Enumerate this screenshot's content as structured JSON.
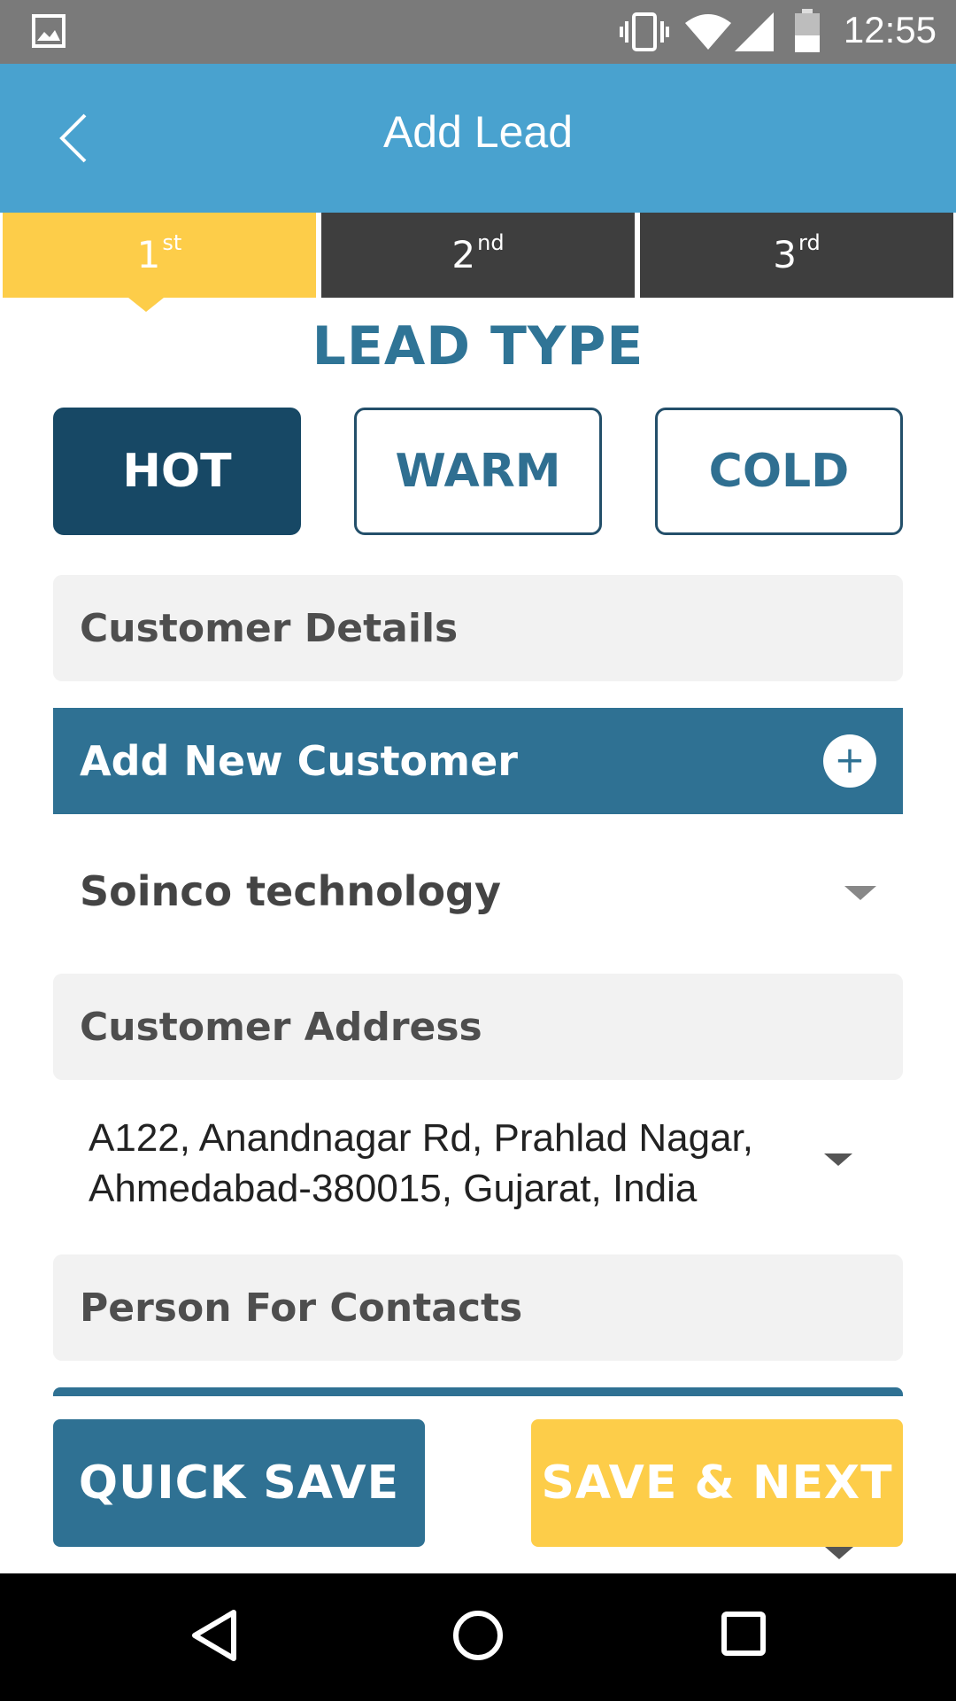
{
  "status_bar": {
    "time": "12:55"
  },
  "app_bar": {
    "title": "Add Lead"
  },
  "steps": [
    {
      "num": "1",
      "suffix": "st"
    },
    {
      "num": "2",
      "suffix": "nd"
    },
    {
      "num": "3",
      "suffix": "rd"
    }
  ],
  "lead_type": {
    "title": "LEAD TYPE",
    "options": [
      "HOT",
      "WARM",
      "COLD"
    ],
    "selected": "HOT"
  },
  "customer_details": {
    "label": "Customer Details",
    "add_new_label": "Add New Customer",
    "selected_customer": "Soinco technology"
  },
  "customer_address": {
    "label": "Customer Address",
    "line1": "A122, Anandnagar Rd, Prahlad Nagar,",
    "line2": "Ahmedabad-380015, Gujarat, India"
  },
  "person_for_contacts": {
    "label": "Person For Contacts"
  },
  "actions": {
    "quick_save": "QUICK SAVE",
    "save_next": "SAVE & NEXT"
  },
  "colors": {
    "app_bar": "#49a2cf",
    "accent_yellow": "#fdcd49",
    "primary_dark": "#174865",
    "primary": "#2f7193"
  }
}
